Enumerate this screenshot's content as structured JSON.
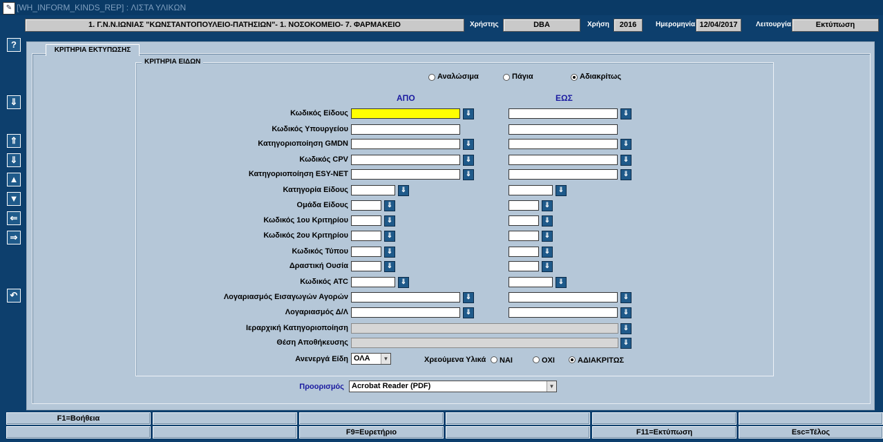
{
  "window": {
    "title": "[WH_INFORM_KINDS_REP]  :  ΛΙΣΤΑ ΥΛΙΚΩΝ",
    "app_icon_glyph": "✎"
  },
  "header": {
    "organization": "1. Γ.Ν.Ν.ΙΩΝΙΑΣ \"ΚΩΝΣΤΑΝΤΟΠΟΥΛΕΙΟ-ΠΑΤΗΣΙΩΝ\"- 1. ΝΟΣΟΚΟΜΕΙΟ- 7. ΦΑΡΜΑΚΕΙΟ",
    "user_label": "Χρήστης",
    "user_value": "DBA",
    "year_label": "Χρήση",
    "year_value": "2016",
    "date_label": "Ημερομηνία",
    "date_value": "12/04/2017",
    "function_label": "Λειτουργία",
    "function_value": "Εκτύπωση"
  },
  "toolbar": {
    "help": "?",
    "down_arrow": "⇓",
    "first": "⇑",
    "last": "⇓",
    "prev": "▲",
    "next": "▼",
    "left": "⇐",
    "right": "⇒",
    "undo": "↶"
  },
  "tab": {
    "label": "ΚΡΙΤΗΡΙΑ ΕΚΤΥΠΩΣΗΣ"
  },
  "group": {
    "label": "ΚΡΙΤΗΡΙΑ ΕΙΔΩΝ",
    "type_options": [
      "Αναλώσιμα",
      "Πάγια",
      "Αδιακρίτως"
    ],
    "type_selected": "Αδιακρίτως",
    "from_header": "ΑΠΟ",
    "to_header": "ΕΩΣ",
    "lov_glyph": "⇓",
    "rows": [
      {
        "label": "Κωδικός Είδους"
      },
      {
        "label": "Κωδικός Υπουργείου"
      },
      {
        "label": "Κατηγοριοποίηση GMDN"
      },
      {
        "label": "Κωδικός CPV"
      },
      {
        "label": "Κατηγοριοποίηση ESY-NET"
      },
      {
        "label": "Κατηγορία Είδους"
      },
      {
        "label": "Ομάδα Είδους"
      },
      {
        "label": "Κωδικός 1ου Κριτηρίου"
      },
      {
        "label": "Κωδικός 2ου Κριτηρίου"
      },
      {
        "label": "Κωδικός Τύπου"
      },
      {
        "label": "Δραστική Ουσία"
      },
      {
        "label": "Κωδικός ATC"
      },
      {
        "label": "Λογαριασμός Εισαγωγών Αγορών"
      },
      {
        "label": "Λογαριασμός Δ/Λ"
      },
      {
        "label": "Ιεραρχική Κατηγοριοποίηση"
      },
      {
        "label": "Θέση Αποθήκευσης"
      }
    ],
    "inactive_label": "Ανενεργά Είδη",
    "inactive_value": "ΟΛΑ",
    "charged_label": "Χρεούμενα Υλικά",
    "charged_options": [
      "ΝΑΙ",
      "ΟΧΙ",
      "ΑΔΙΑΚΡΙΤΩΣ"
    ],
    "charged_selected": "ΑΔΙΑΚΡΙΤΩΣ"
  },
  "destination": {
    "label": "Προορισμός",
    "value": "Acrobat Reader (PDF)"
  },
  "function_keys": {
    "row1": [
      "F1=Βοήθεια",
      "",
      "",
      "",
      "",
      ""
    ],
    "row2": [
      "",
      "",
      "F9=Ευρετήριο",
      "",
      "F11=Εκτύπωση",
      "Esc=Τέλος"
    ]
  },
  "colors": {
    "background": "#0d3f6d",
    "panel": "#b5c7d8",
    "header_field": "#c9c9c9",
    "focus_field": "#ffff00",
    "column_header": "#1a1aa0",
    "lov_button": "#1f5a8a"
  }
}
